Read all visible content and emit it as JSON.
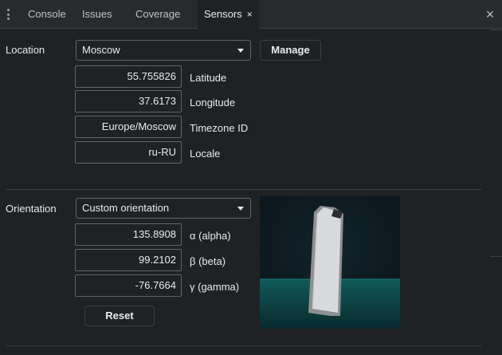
{
  "tabs": [
    {
      "label": "Console"
    },
    {
      "label": "Issues"
    },
    {
      "label": "Coverage"
    },
    {
      "label": "Sensors"
    }
  ],
  "tab_close_glyph": "×",
  "panel_close_glyph": "×",
  "location": {
    "label": "Location",
    "selected": "Moscow",
    "manage_label": "Manage",
    "fields": [
      {
        "value": "55.755826",
        "label": "Latitude"
      },
      {
        "value": "37.6173",
        "label": "Longitude"
      },
      {
        "value": "Europe/Moscow",
        "label": "Timezone ID"
      },
      {
        "value": "ru-RU",
        "label": "Locale"
      }
    ]
  },
  "orientation": {
    "label": "Orientation",
    "selected": "Custom orientation",
    "reset_label": "Reset",
    "fields": [
      {
        "value": "135.8908",
        "label": "α (alpha)"
      },
      {
        "value": "99.2102",
        "label": "β (beta)"
      },
      {
        "value": "-76.7664",
        "label": "γ (gamma)"
      }
    ]
  },
  "colors": {
    "background": "#202124",
    "tabbar": "#292a2d",
    "device_scene": "#0e1a21",
    "device_floor": "#0f5a5a"
  },
  "icons": {
    "menu": "kebab-menu-icon",
    "dropdown": "chevron-down-icon",
    "close": "close-icon"
  }
}
